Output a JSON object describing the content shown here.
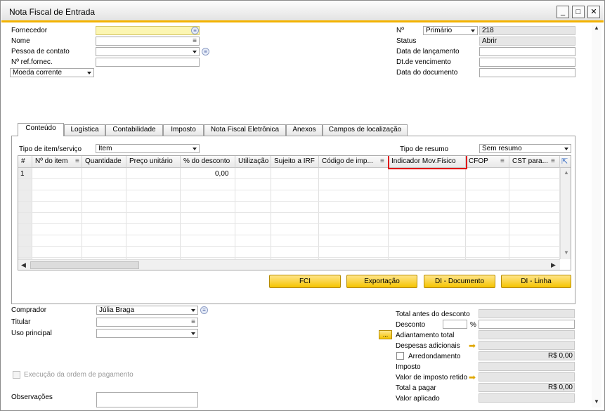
{
  "window": {
    "title": "Nota Fiscal de Entrada",
    "minimize": "_",
    "maximize": "□",
    "close": "✕"
  },
  "header_left": {
    "fornecedor_label": "Fornecedor",
    "fornecedor_value": "",
    "nome_label": "Nome",
    "nome_value": "",
    "contato_label": "Pessoa de contato",
    "contato_value": "",
    "ref_label": "Nº ref.fornec.",
    "ref_value": "",
    "moeda_select": "Moeda corrente"
  },
  "header_right": {
    "numero_label": "Nº",
    "numero_series": "Primário",
    "numero_value": "218",
    "status_label": "Status",
    "status_value": "Abrir",
    "lancamento_label": "Data de lançamento",
    "lancamento_value": "",
    "vencimento_label": "Dt.de vencimento",
    "vencimento_value": "",
    "documento_label": "Data do documento",
    "documento_value": ""
  },
  "tabs": [
    {
      "label": "Conteúdo"
    },
    {
      "label": "Logística"
    },
    {
      "label": "Contabilidade"
    },
    {
      "label": "Imposto"
    },
    {
      "label": "Nota Fiscal Eletrônica"
    },
    {
      "label": "Anexos"
    },
    {
      "label": "Campos de localização"
    }
  ],
  "content": {
    "item_type_label": "Tipo de item/serviço",
    "item_type_value": "Item",
    "summary_label": "Tipo de resumo",
    "summary_value": "Sem resumo",
    "columns": [
      "#",
      "Nº do item",
      "Quantidade",
      "Preço unitário",
      "% do desconto",
      "Utilização",
      "Sujeito a IRF",
      "Código de imp...",
      "Indicador Mov.Físico",
      "CFOP",
      "CST para..."
    ],
    "first_row": {
      "num": "1",
      "discount": "0,00"
    },
    "highlight_color": "#e00000"
  },
  "buttons": {
    "fci": "FCI",
    "export": "Exportação",
    "di_doc": "DI - Documento",
    "di_line": "DI - Linha"
  },
  "footer_left": {
    "comprador_label": "Comprador",
    "comprador_value": "Júlia Braga",
    "titular_label": "Titular",
    "titular_value": "",
    "uso_label": "Uso principal",
    "uso_value": "",
    "execucao_label": "Execução da ordem de pagamento",
    "obs_label": "Observações"
  },
  "footer_right": {
    "total_antes_label": "Total antes do desconto",
    "desconto_label": "Desconto",
    "desconto_pct": "%",
    "adiantamento_label": "Adiantamento total",
    "adiantamento_btn": "...",
    "despesas_label": "Despesas adicionais",
    "arredondamento_label": "Arredondamento",
    "arredondamento_value": "R$ 0,00",
    "imposto_label": "Imposto",
    "retido_label": "Valor de imposto retido",
    "total_label": "Total a pagar",
    "total_value": "R$ 0,00",
    "aplicado_label": "Valor aplicado"
  },
  "colors": {
    "accent": "#f3b200",
    "button": "#f5c400"
  }
}
